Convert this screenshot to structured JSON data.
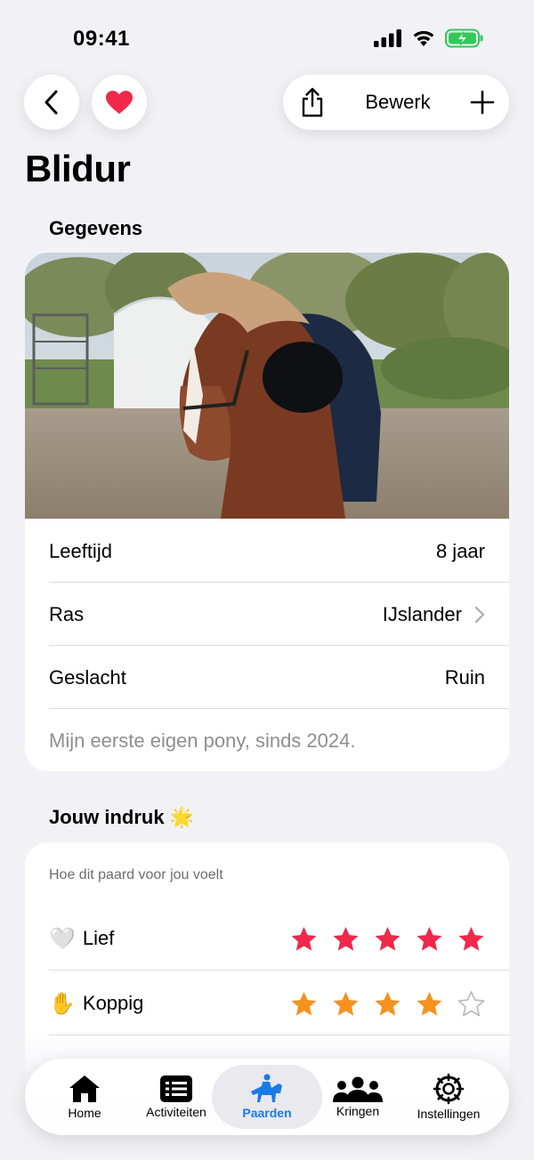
{
  "status": {
    "time": "09:41"
  },
  "nav": {
    "edit_label": "Bewerk"
  },
  "title": "Blidur",
  "details": {
    "section_title": "Gegevens",
    "rows": [
      {
        "label": "Leeftijd",
        "value": "8 jaar"
      },
      {
        "label": "Ras",
        "value": "IJslander"
      },
      {
        "label": "Geslacht",
        "value": "Ruin"
      }
    ],
    "note": "Mijn eerste eigen pony, sinds 2024."
  },
  "impression": {
    "section_title": "Jouw indruk",
    "section_emoji": "🌟",
    "subtitle": "Hoe dit paard voor jou voelt",
    "ratings": [
      {
        "emoji": "🤍",
        "label": "Lief",
        "stars": 5,
        "max": 5,
        "color": "#f0284a"
      },
      {
        "emoji": "✋",
        "label": "Koppig",
        "stars": 4,
        "max": 5,
        "color": "#f5921e"
      }
    ]
  },
  "tabs": [
    {
      "label": "Home",
      "icon": "home-icon",
      "active": false
    },
    {
      "label": "Activiteiten",
      "icon": "list-icon",
      "active": false
    },
    {
      "label": "Paarden",
      "icon": "horse-rider-icon",
      "active": true
    },
    {
      "label": "Kringen",
      "icon": "group-icon",
      "active": false
    },
    {
      "label": "Instellingen",
      "icon": "gear-icon",
      "active": false
    }
  ],
  "colors": {
    "accent": "#1a7be8",
    "heart": "#f0284a",
    "background": "#f2f2f6"
  }
}
